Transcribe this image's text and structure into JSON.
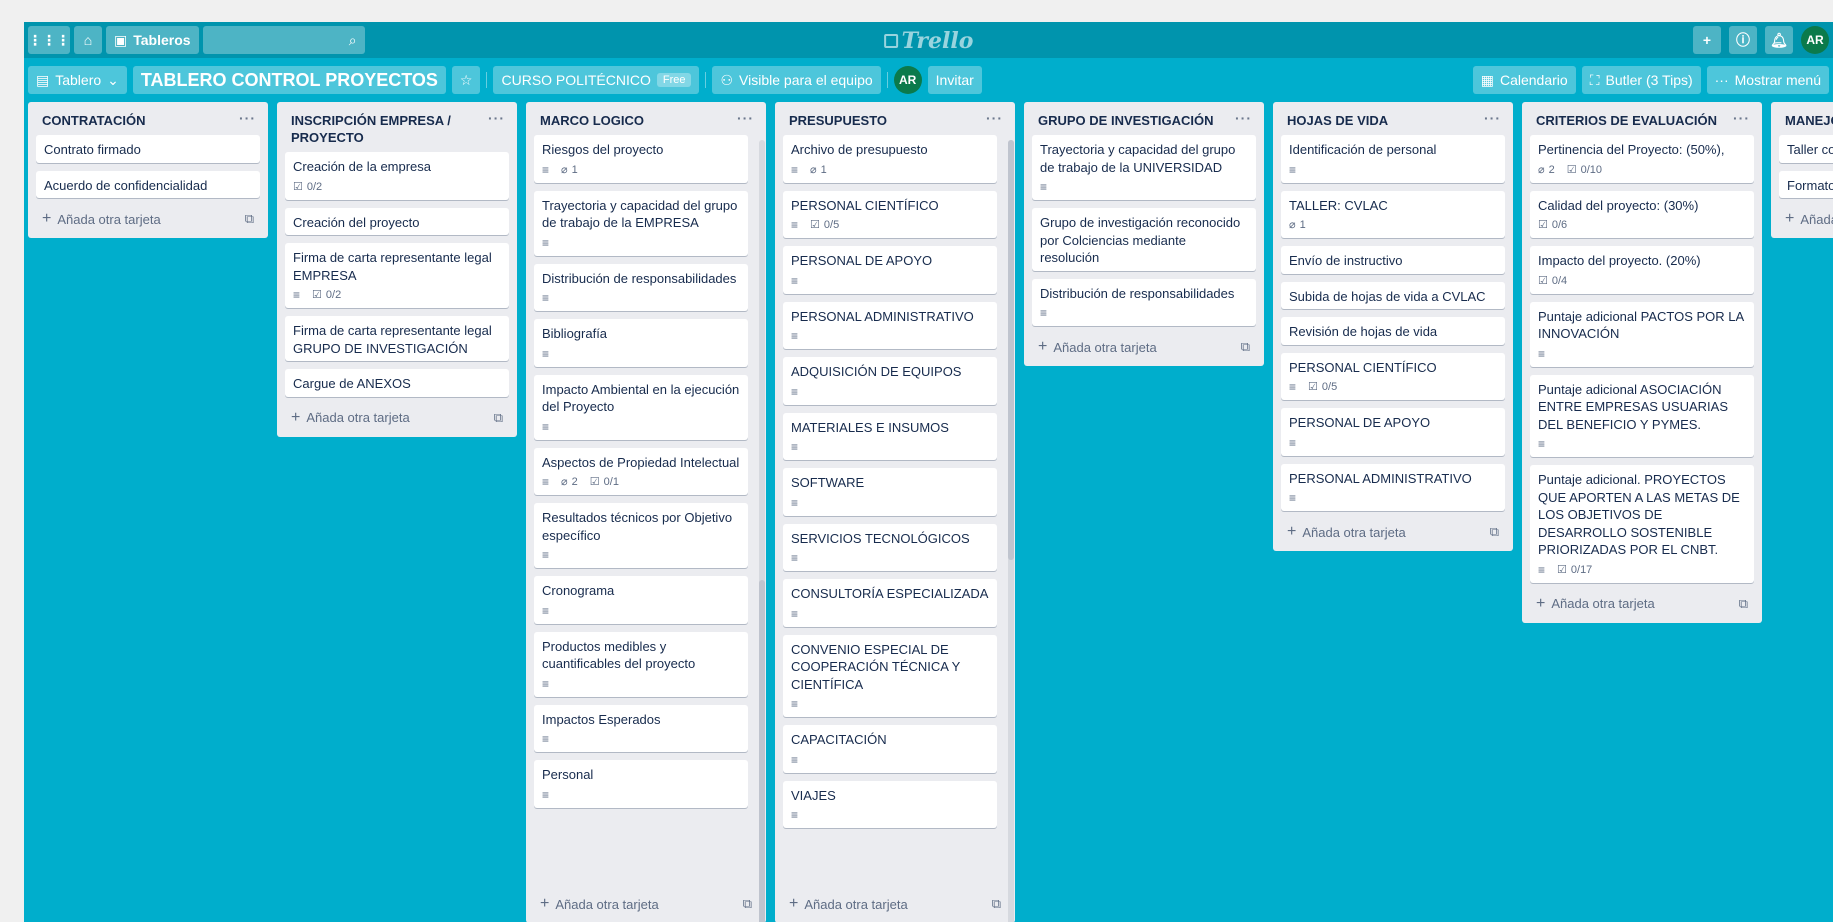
{
  "header": {
    "boards_label": "Tableros",
    "logo": "Trello",
    "avatar": "AR",
    "icons": [
      "apps-icon",
      "home-icon",
      "search-icon",
      "plus-icon",
      "info-icon",
      "bell-icon"
    ]
  },
  "board": {
    "view": "Tablero",
    "title": "TABLERO CONTROL PROYECTOS",
    "team": "CURSO POLITÉCNICO",
    "plan": "Free",
    "visibility": "Visible para el equipo",
    "member": "AR",
    "invite": "Invitar",
    "calendar": "Calendario",
    "butler": "Butler (3 Tips)",
    "menu": "Mostrar menú"
  },
  "add_card_label": "Añada otra tarjeta",
  "lists": [
    {
      "title": "CONTRATACIÓN",
      "cards": [
        {
          "title": "Contrato firmado"
        },
        {
          "title": "Acuerdo de confidencialidad"
        }
      ]
    },
    {
      "title": "INSCRIPCIÓN EMPRESA / PROYECTO",
      "cards": [
        {
          "title": "Creación de la empresa",
          "check": "0/2"
        },
        {
          "title": "Creación del proyecto"
        },
        {
          "title": "Firma de carta representante legal EMPRESA",
          "desc": true,
          "check": "0/2"
        },
        {
          "title": "Firma de carta representante legal GRUPO DE INVESTIGACIÓN"
        },
        {
          "title": "Cargue de ANEXOS"
        }
      ]
    },
    {
      "title": "MARCO LOGICO",
      "cards": [
        {
          "title": "Riesgos del proyecto",
          "desc": true,
          "attach": "1"
        },
        {
          "title": "Trayectoria y capacidad del grupo de trabajo de la EMPRESA",
          "desc": true
        },
        {
          "title": "Distribución de responsabilidades",
          "desc": true
        },
        {
          "title": "Bibliografía",
          "desc": true
        },
        {
          "title": "Impacto Ambiental en la ejecución del Proyecto",
          "desc": true
        },
        {
          "title": "Aspectos de Propiedad Intelectual",
          "desc": true,
          "attach": "2",
          "check": "0/1"
        },
        {
          "title": "Resultados técnicos por Objetivo específico",
          "desc": true
        },
        {
          "title": "Cronograma",
          "desc": true
        },
        {
          "title": "Productos medibles y cuantificables del proyecto",
          "desc": true
        },
        {
          "title": "Impactos Esperados",
          "desc": true
        },
        {
          "title": "Personal",
          "desc": true
        }
      ]
    },
    {
      "title": "PRESUPUESTO",
      "cards": [
        {
          "title": "Archivo de presupuesto",
          "desc": true,
          "attach": "1"
        },
        {
          "title": "PERSONAL CIENTÍFICO",
          "desc": true,
          "check": "0/5"
        },
        {
          "title": "PERSONAL DE APOYO",
          "desc": true
        },
        {
          "title": "PERSONAL ADMINISTRATIVO",
          "desc": true
        },
        {
          "title": "ADQUISICIÓN DE EQUIPOS",
          "desc": true
        },
        {
          "title": "MATERIALES E INSUMOS",
          "desc": true
        },
        {
          "title": "SOFTWARE",
          "desc": true
        },
        {
          "title": "SERVICIOS TECNOLÓGICOS",
          "desc": true
        },
        {
          "title": "CONSULTORÍA ESPECIALIZADA",
          "desc": true
        },
        {
          "title": "CONVENIO ESPECIAL DE COOPERACIÓN TÉCNICA Y CIENTÍFICA",
          "desc": true
        },
        {
          "title": "CAPACITACIÓN",
          "desc": true
        },
        {
          "title": "VIAJES",
          "desc": true
        }
      ]
    },
    {
      "title": "GRUPO DE INVESTIGACIÓN",
      "cards": [
        {
          "title": "Trayectoria y capacidad del grupo de trabajo de la UNIVERSIDAD",
          "desc": true
        },
        {
          "title": "Grupo de investigación reconocido por Colciencias mediante resolución"
        },
        {
          "title": "Distribución de responsabilidades",
          "desc": true
        }
      ]
    },
    {
      "title": "HOJAS DE VIDA",
      "cards": [
        {
          "title": "Identificación de personal",
          "desc": true
        },
        {
          "title": "TALLER: CVLAC",
          "attach": "1"
        },
        {
          "title": "Envío de instructivo"
        },
        {
          "title": "Subida de hojas de vida a CVLAC"
        },
        {
          "title": "Revisión de hojas de vida"
        },
        {
          "title": "PERSONAL CIENTÍFICO",
          "desc": true,
          "check": "0/5"
        },
        {
          "title": "PERSONAL DE APOYO",
          "desc": true
        },
        {
          "title": "PERSONAL ADMINISTRATIVO",
          "desc": true
        }
      ]
    },
    {
      "title": "CRITERIOS DE EVALUACIÓN",
      "cards": [
        {
          "title": "Pertinencia del Proyecto: (50%),",
          "attach": "2",
          "check": "0/10"
        },
        {
          "title": "Calidad del proyecto: (30%)",
          "check": "0/6"
        },
        {
          "title": "Impacto del proyecto. (20%)",
          "check": "0/4"
        },
        {
          "title": "Puntaje adicional PACTOS POR LA INNOVACIÓN",
          "desc": true
        },
        {
          "title": "Puntaje adicional ASOCIACIÓN ENTRE EMPRESAS USUARIAS DEL BENEFICIO Y PYMES.",
          "desc": true
        },
        {
          "title": "Puntaje adicional. PROYECTOS QUE APORTEN A LAS METAS DE LOS OBJETIVOS DE DESARROLLO SOSTENIBLE PRIORIZADAS POR EL CNBT.",
          "desc": true,
          "check": "0/17"
        }
      ]
    },
    {
      "title": "MANEJO FORMATOS",
      "cards": [
        {
          "title": "Taller con"
        },
        {
          "title": "Formatos"
        }
      ]
    }
  ]
}
